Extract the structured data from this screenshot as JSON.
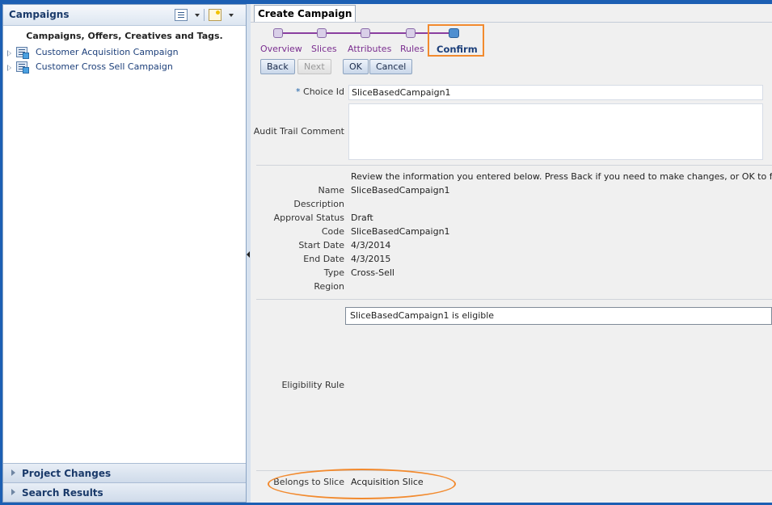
{
  "left_panel": {
    "title": "Campaigns",
    "tree_heading": "Campaigns, Offers, Creatives and Tags.",
    "tree_items": [
      {
        "label": "Customer Acquisition Campaign"
      },
      {
        "label": "Customer Cross Sell Campaign"
      }
    ],
    "accordions": [
      {
        "label": "Project Changes"
      },
      {
        "label": "Search Results"
      }
    ]
  },
  "tab": {
    "label": "Create Campaign"
  },
  "train": {
    "steps": [
      {
        "label": "Overview"
      },
      {
        "label": "Slices"
      },
      {
        "label": "Attributes"
      },
      {
        "label": "Rules"
      },
      {
        "label": "Confirm",
        "current": true
      }
    ]
  },
  "buttons": {
    "back": "Back",
    "next": "Next",
    "ok": "OK",
    "cancel": "Cancel"
  },
  "form": {
    "choice_id_required_mark": "*",
    "choice_id_label": "Choice Id",
    "choice_id_value": "SliceBasedCampaign1",
    "audit_trail_label": "Audit Trail Comment",
    "audit_trail_value": ""
  },
  "review": {
    "instruction": "Review the information you entered below. Press Back if you need to make changes, or OK to finish.",
    "fields": [
      {
        "label": "Name",
        "value": "SliceBasedCampaign1"
      },
      {
        "label": "Description",
        "value": ""
      },
      {
        "label": "Approval Status",
        "value": "Draft"
      },
      {
        "label": "Code",
        "value": "SliceBasedCampaign1"
      },
      {
        "label": "Start Date",
        "value": "4/3/2014"
      },
      {
        "label": "End Date",
        "value": "4/3/2015"
      },
      {
        "label": "Type",
        "value": "Cross-Sell"
      },
      {
        "label": "Region",
        "value": ""
      }
    ]
  },
  "eligibility": {
    "label": "Eligibility Rule",
    "rule_text": "SliceBasedCampaign1 is eligible"
  },
  "slice": {
    "label": "Belongs to Slice",
    "value": "Acquisition Slice"
  },
  "colors": {
    "frame_blue": "#1c5fb3",
    "highlight_orange": "#f28a2e",
    "train_purple": "#8a3fa0"
  }
}
